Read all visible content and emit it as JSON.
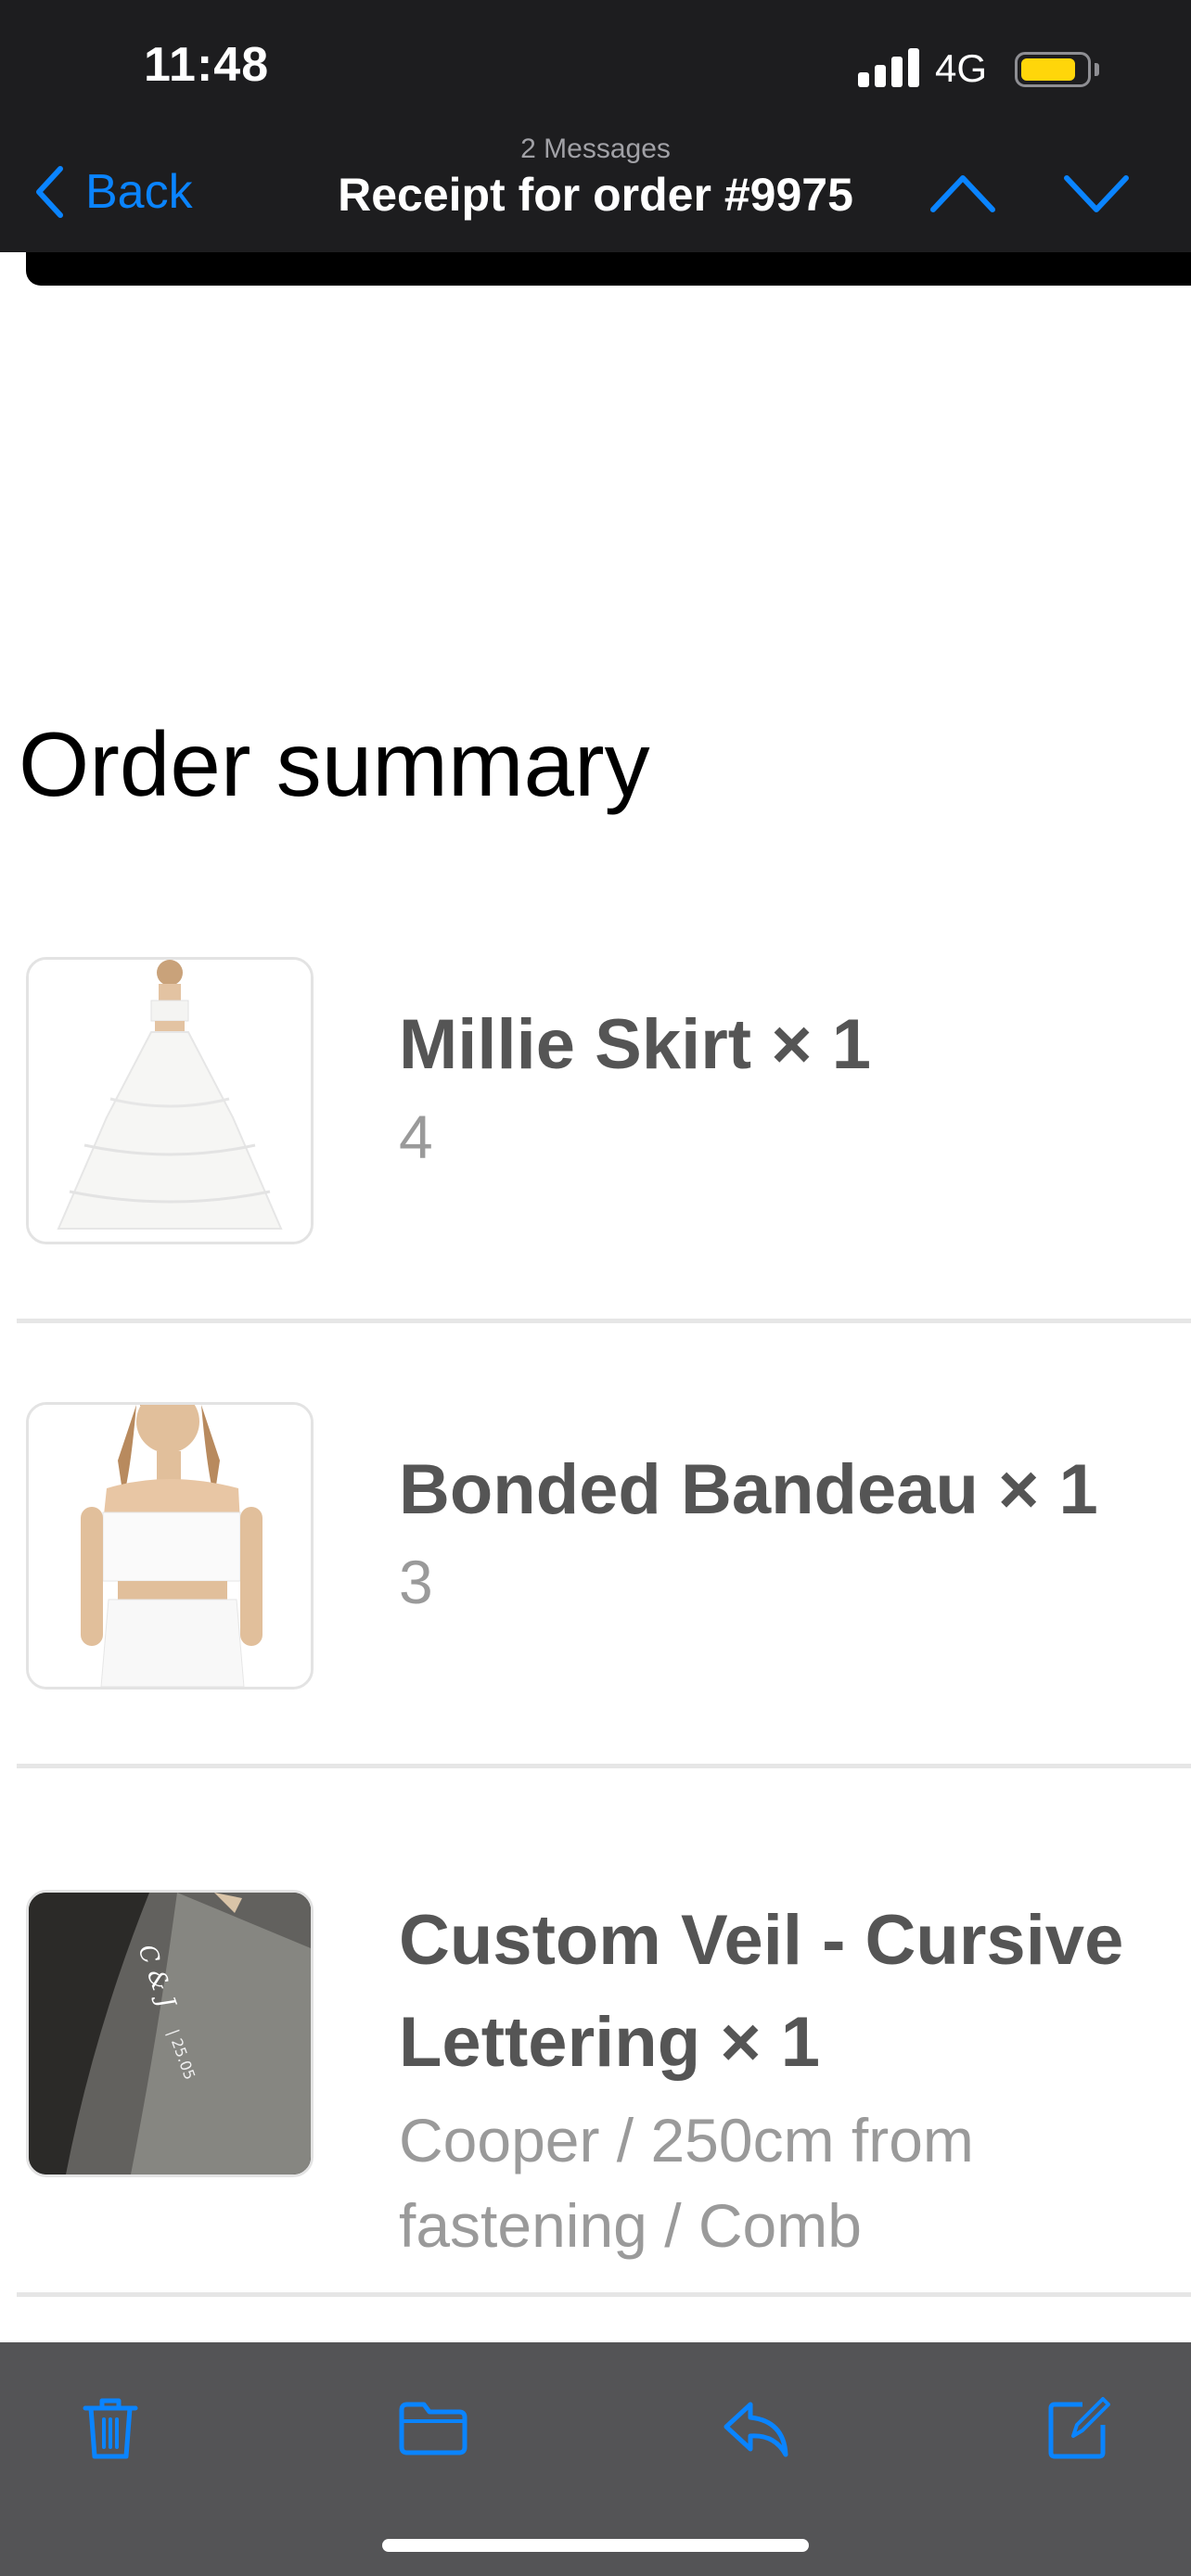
{
  "status_bar": {
    "time": "11:48",
    "network": "4G",
    "battery_level": 0.85,
    "battery_color": "#ffd60a"
  },
  "nav": {
    "back_label": "Back",
    "subtitle": "2 Messages",
    "title": "Receipt for order #9975",
    "accent_color": "#0a84ff",
    "icons": {
      "back": "chevron-left-icon",
      "previous": "chevron-up-icon",
      "next": "chevron-down-icon"
    }
  },
  "email": {
    "section_heading": "Order summary",
    "items": [
      {
        "name": "Millie Skirt × 1",
        "variant": "4",
        "image": "white-tiered-skirt-photo"
      },
      {
        "name": "Bonded Bandeau × 1",
        "variant": "3",
        "image": "white-bandeau-top-photo"
      },
      {
        "name": "Custom Veil - Cursive Lettering × 1",
        "variant": "Cooper / 250cm from fastening / Comb",
        "image": "embroidered-veil-photo"
      }
    ]
  },
  "toolbar": {
    "icons": [
      "trash-icon",
      "folder-icon",
      "reply-icon",
      "compose-icon"
    ]
  }
}
